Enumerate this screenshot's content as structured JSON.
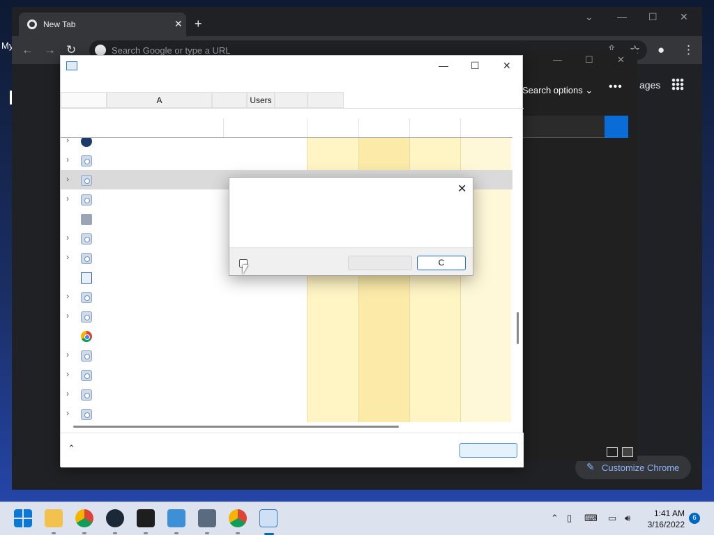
{
  "desktop": {
    "label_fragment": "My"
  },
  "chrome": {
    "tab_title": "New Tab",
    "omnibox_placeholder": "Search Google or type a URL",
    "images_link": "ages",
    "customize_label": "Customize Chrome",
    "search_options": "Search options"
  },
  "task_manager": {
    "tabs": [
      "",
      "A",
      "",
      "Users",
      "",
      ""
    ],
    "selected_row_index": 2
  },
  "dialog": {
    "button2_label": "C"
  },
  "taskbar": {
    "apps": [
      "start-icon",
      "file-explorer-icon",
      "chrome-icon",
      "steam-icon",
      "terminal-icon",
      "notepad-icon",
      "calculator-icon",
      "chrome-icon",
      "task-manager-icon"
    ],
    "time": "1:41 AM",
    "date": "3/16/2022",
    "notification_count": "6"
  },
  "colors": {
    "chrome_bg": "#202124",
    "accent": "#0067c0",
    "column_highlight": "#fff4c4",
    "column_highlight_strong": "#fbeaa8"
  }
}
